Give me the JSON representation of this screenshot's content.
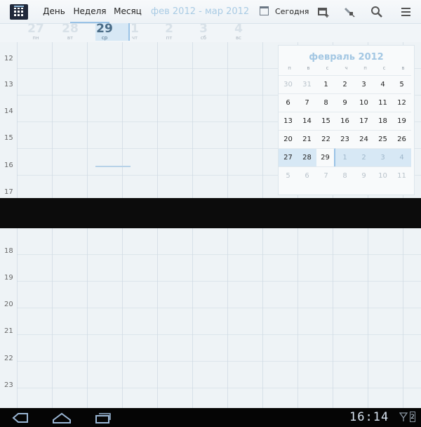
{
  "tabs": [
    {
      "label": "День"
    },
    {
      "label": "Неделя"
    },
    {
      "label": "Месяц"
    }
  ],
  "date_range": "фев 2012 - мар 2012",
  "today_label": "Сегодня",
  "icons": {
    "app": "calendar-app-icon",
    "today": "calendar-today-icon",
    "add_event": "add-event-icon",
    "edit": "edit-icon",
    "search": "search-icon",
    "menu": "menu-icon",
    "back": "back-icon",
    "home": "home-icon",
    "recent": "recent-apps-icon"
  },
  "week_days": [
    {
      "num": "27",
      "dow": "пн"
    },
    {
      "num": "28",
      "dow": "вт"
    },
    {
      "num": "29",
      "dow": "ср"
    },
    {
      "num": "1",
      "dow": "чт"
    },
    {
      "num": "2",
      "dow": "пт"
    },
    {
      "num": "3",
      "dow": "сб"
    },
    {
      "num": "4",
      "dow": "вс"
    }
  ],
  "hours_top": [
    "12",
    "13",
    "14",
    "15",
    "16",
    "17"
  ],
  "hours_bottom": [
    "18",
    "19",
    "20",
    "21",
    "22",
    "23"
  ],
  "mini_month": {
    "title": "февраль 2012",
    "weekdays": [
      "п",
      "в",
      "с",
      "ч",
      "п",
      "с",
      "в"
    ],
    "weeks": [
      [
        "30",
        "31",
        "1",
        "2",
        "3",
        "4",
        "5"
      ],
      [
        "6",
        "7",
        "8",
        "9",
        "10",
        "11",
        "12"
      ],
      [
        "13",
        "14",
        "15",
        "16",
        "17",
        "18",
        "19"
      ],
      [
        "20",
        "21",
        "22",
        "23",
        "24",
        "25",
        "26"
      ],
      [
        "27",
        "28",
        "29",
        "1",
        "2",
        "3",
        "4"
      ],
      [
        "5",
        "6",
        "7",
        "8",
        "9",
        "10",
        "11"
      ]
    ]
  },
  "status": {
    "time": "16:14",
    "battery_level": "2"
  },
  "colors": {
    "accent": "#9ac3e6",
    "selected_week": "#d7e8f5",
    "title_blue": "#a3c7e3"
  }
}
